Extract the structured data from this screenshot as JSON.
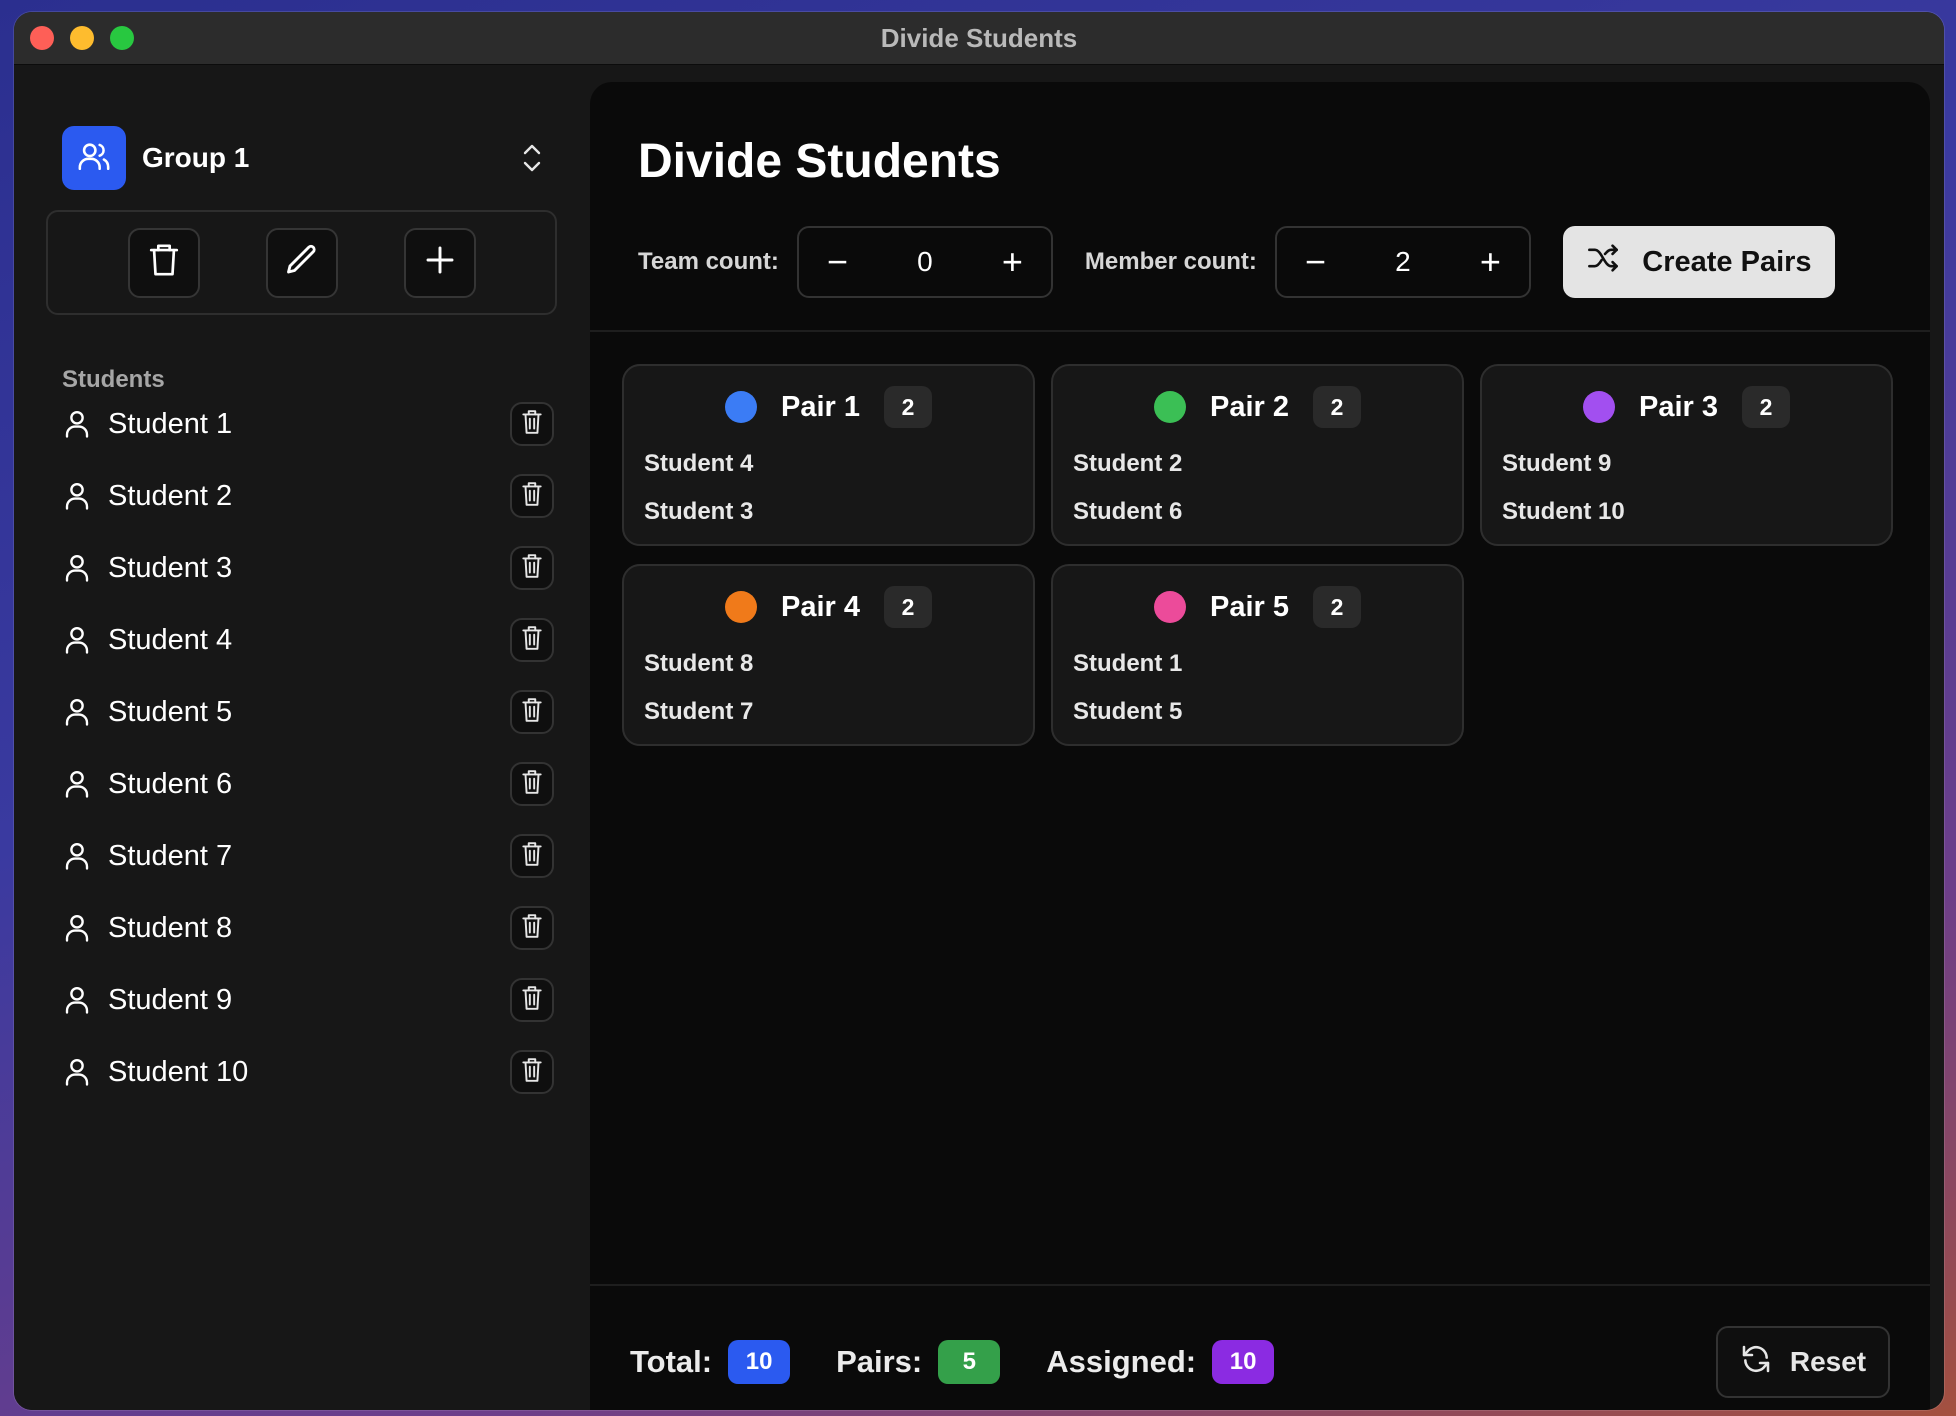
{
  "window": {
    "title": "Divide Students",
    "traffic_lights": [
      "#fe5f57",
      "#febc2e",
      "#28c840"
    ]
  },
  "sidebar": {
    "group": {
      "name": "Group 1",
      "icon": "users-icon",
      "accent": "#2b5af0"
    },
    "toolbar": [
      {
        "name": "delete-group-button",
        "icon": "trash-icon"
      },
      {
        "name": "edit-group-button",
        "icon": "pencil-icon"
      },
      {
        "name": "add-student-button",
        "icon": "plus-icon"
      }
    ],
    "students_label": "Students",
    "students": [
      "Student 1",
      "Student 2",
      "Student 3",
      "Student 4",
      "Student 5",
      "Student 6",
      "Student 7",
      "Student 8",
      "Student 9",
      "Student 10"
    ]
  },
  "main": {
    "title": "Divide Students",
    "team_count": {
      "label": "Team count:",
      "value": "0",
      "minus": "−",
      "plus": "+"
    },
    "member_count": {
      "label": "Member count:",
      "value": "2",
      "minus": "−",
      "plus": "+"
    },
    "create_button": {
      "label": "Create Pairs",
      "icon": "shuffle-icon"
    },
    "pairs": [
      {
        "name": "Pair 1",
        "count": "2",
        "color": "#3b7cf5",
        "members": [
          "Student 4",
          "Student 3"
        ]
      },
      {
        "name": "Pair 2",
        "count": "2",
        "color": "#3bbf55",
        "members": [
          "Student 2",
          "Student 6"
        ]
      },
      {
        "name": "Pair 3",
        "count": "2",
        "color": "#a24ff0",
        "members": [
          "Student 9",
          "Student 10"
        ]
      },
      {
        "name": "Pair 4",
        "count": "2",
        "color": "#f07a1a",
        "members": [
          "Student 8",
          "Student 7"
        ]
      },
      {
        "name": "Pair 5",
        "count": "2",
        "color": "#ec4b9a",
        "members": [
          "Student 1",
          "Student 5"
        ]
      }
    ],
    "footer": {
      "total": {
        "label": "Total:",
        "value": "10",
        "color": "#2b5af0"
      },
      "pairs": {
        "label": "Pairs:",
        "value": "5",
        "color": "#34a04a"
      },
      "assigned": {
        "label": "Assigned:",
        "value": "10",
        "color": "#8b2be2"
      },
      "reset": {
        "label": "Reset",
        "icon": "refresh-icon"
      }
    }
  }
}
